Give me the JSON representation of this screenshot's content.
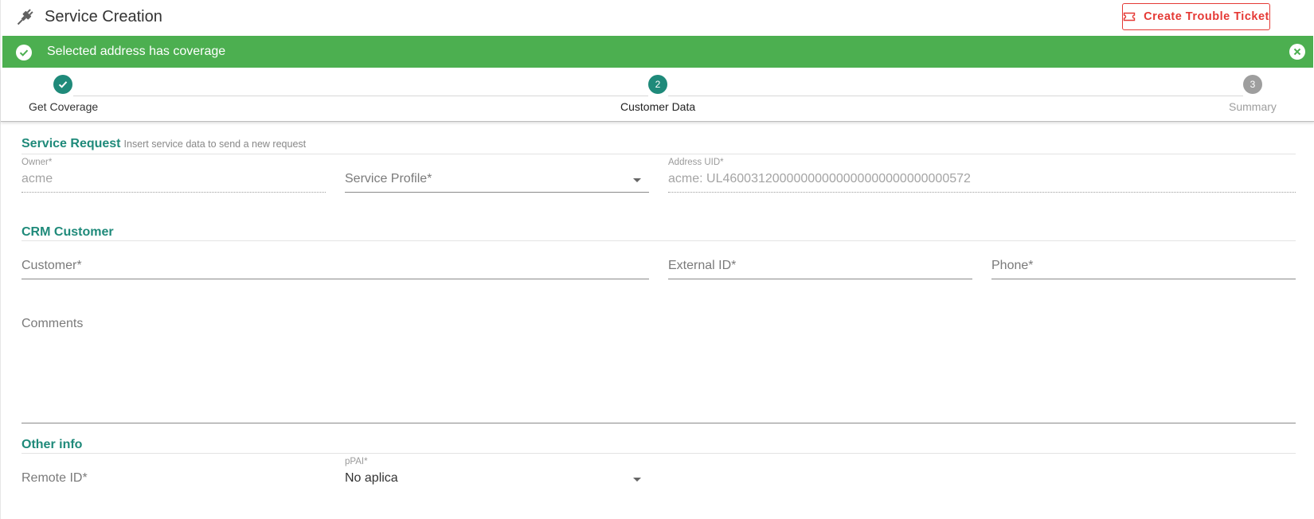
{
  "header": {
    "title": "Service Creation",
    "trouble_ticket_label": "Create Trouble Ticket"
  },
  "alert": {
    "message": "Selected address has coverage",
    "color": "#4caf50"
  },
  "stepper": {
    "steps": [
      {
        "label": "Get Coverage",
        "number": "",
        "state": "completed"
      },
      {
        "label": "Customer Data",
        "number": "2",
        "state": "active"
      },
      {
        "label": "Summary",
        "number": "3",
        "state": "pending"
      }
    ],
    "active_color": "#1f8a7a",
    "pending_color": "#9e9e9e"
  },
  "service_request": {
    "title": "Service Request",
    "subtitle": "Insert service data to send a new request",
    "owner": {
      "label": "Owner*",
      "value": "acme"
    },
    "service_profile": {
      "placeholder": "Service Profile*"
    },
    "address_uid": {
      "label": "Address UID*",
      "value": "acme: UL46003120000000000000000000000000572"
    }
  },
  "crm_customer": {
    "title": "CRM Customer",
    "customer": {
      "placeholder": "Customer*"
    },
    "external_id": {
      "placeholder": "External ID*"
    },
    "phone": {
      "placeholder": "Phone*"
    },
    "comments": {
      "placeholder": "Comments"
    }
  },
  "other_info": {
    "title": "Other info",
    "remote_id": {
      "placeholder": "Remote ID*"
    },
    "ppai": {
      "label": "pPAI*",
      "value": "No aplica"
    }
  }
}
